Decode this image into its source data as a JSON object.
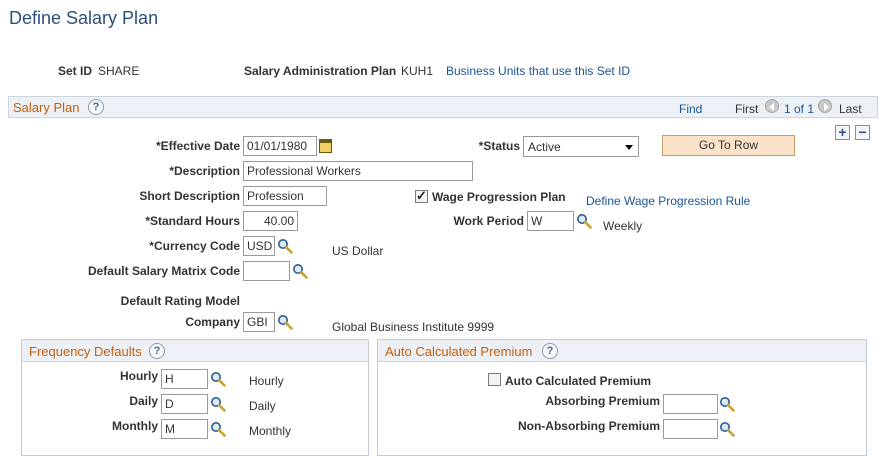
{
  "page": {
    "title": "Define Salary Plan"
  },
  "header": {
    "set_id_label": "Set ID",
    "set_id_value": "SHARE",
    "plan_label": "Salary Administration Plan",
    "plan_value": "KUH1",
    "business_units_link": "Business Units that use this Set ID"
  },
  "salary_plan": {
    "title": "Salary Plan",
    "find": "Find",
    "first": "First",
    "count": "1 of 1",
    "last": "Last",
    "add": "+",
    "remove": "−",
    "effective_date_label": "*Effective Date",
    "effective_date_value": "01/01/1980",
    "status_label": "*Status",
    "status_value": "Active",
    "go_to_row": "Go To Row",
    "description_label": "*Description",
    "description_value": "Professional Workers",
    "short_description_label": "Short Description",
    "short_description_value": "Profession",
    "wage_progression_label": "Wage Progression Plan",
    "wage_progression_checked": true,
    "wage_progression_link": "Define Wage Progression Rule",
    "standard_hours_label": "*Standard Hours",
    "standard_hours_value": "40.00",
    "work_period_label": "Work Period",
    "work_period_value": "W",
    "work_period_desc": "Weekly",
    "currency_label": "*Currency Code",
    "currency_value": "USD",
    "currency_desc": "US Dollar",
    "matrix_label": "Default Salary Matrix Code",
    "matrix_value": "",
    "rating_model_label": "Default Rating Model",
    "company_label": "Company",
    "company_value": "GBI",
    "company_desc": "Global Business Institute 9999"
  },
  "frequency_defaults": {
    "title": "Frequency Defaults",
    "hourly_label": "Hourly",
    "hourly_value": "H",
    "hourly_desc": "Hourly",
    "daily_label": "Daily",
    "daily_value": "D",
    "daily_desc": "Daily",
    "monthly_label": "Monthly",
    "monthly_value": "M",
    "monthly_desc": "Monthly"
  },
  "auto_premium": {
    "title": "Auto Calculated Premium",
    "checkbox_label": "Auto Calculated Premium",
    "checked": false,
    "absorbing_label": "Absorbing Premium",
    "absorbing_value": "",
    "non_absorbing_label": "Non-Absorbing Premium",
    "non_absorbing_value": ""
  },
  "icons": {
    "lookup": "magnifier-icon",
    "calendar": "calendar-icon",
    "help": "help-icon"
  },
  "colors": {
    "title": "#2b4f7e",
    "section_title": "#c25f10",
    "link": "#1a5596",
    "header_bg": "#edf1f5",
    "button_bg": "#fbe3c9"
  }
}
